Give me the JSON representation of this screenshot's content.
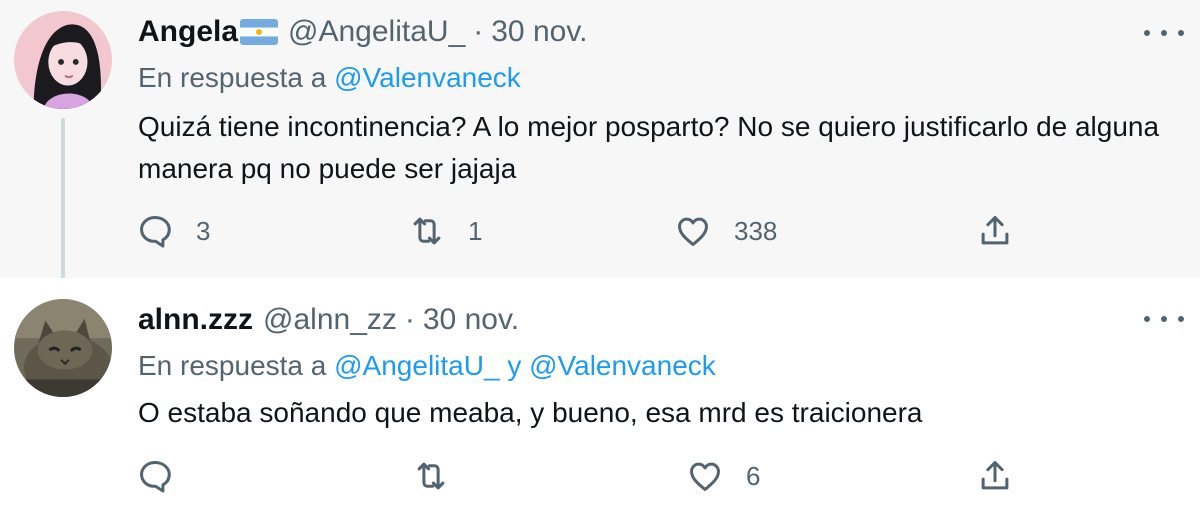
{
  "tweets": [
    {
      "name": "Angela",
      "flag": "argentina-flag-icon",
      "handle": "@AngelitaU_",
      "separator": "·",
      "date": "30 nov.",
      "reply_prefix": "En respuesta a",
      "reply_mentions": [
        "@Valenvaneck"
      ],
      "reply_joiner": "",
      "text": "Quizá tiene incontinencia? A lo mejor posparto? No se quiero justificarlo de alguna manera pq no puede ser jajaja",
      "replies": "3",
      "retweets": "1",
      "likes": "338"
    },
    {
      "name": "alnn.zzz",
      "handle": "@alnn_zz",
      "separator": "·",
      "date": "30 nov.",
      "reply_prefix": "En respuesta a",
      "reply_mentions": [
        "@AngelitaU_",
        "@Valenvaneck"
      ],
      "reply_joiner": "y",
      "text": "O estaba soñando que meaba, y bueno, esa mrd es traicionera",
      "replies": "",
      "retweets": "",
      "likes": "6"
    }
  ],
  "colors": {
    "text": "#0f1419",
    "secondary": "#536471",
    "link": "#1d9bf0",
    "thread_line": "#cfd9de",
    "highlight_bg": "#f7f7f7"
  }
}
